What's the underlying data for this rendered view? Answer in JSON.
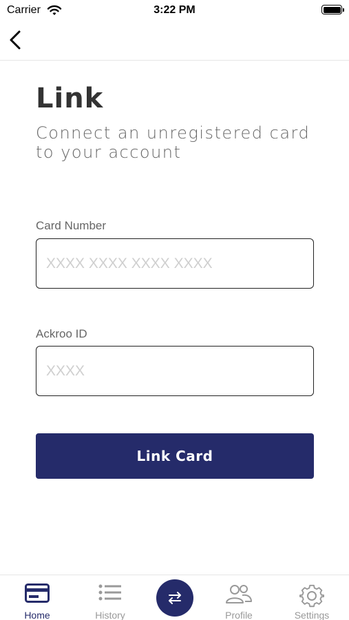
{
  "status_bar": {
    "carrier": "Carrier",
    "time": "3:22 PM"
  },
  "page": {
    "title": "Link",
    "subtitle": "Connect an unregistered card to your account"
  },
  "form": {
    "card_number": {
      "label": "Card Number",
      "placeholder": "XXXX XXXX XXXX XXXX",
      "value": ""
    },
    "ackroo_id": {
      "label": "Ackroo ID",
      "placeholder": "XXXX",
      "value": ""
    },
    "submit_label": "Link Card"
  },
  "tab_bar": {
    "tabs": [
      {
        "label": "Home",
        "icon": "card-icon",
        "active": true
      },
      {
        "label": "History",
        "icon": "list-icon",
        "active": false
      },
      {
        "label": "",
        "icon": "swap-arrows-icon",
        "active": false
      },
      {
        "label": "Profile",
        "icon": "people-icon",
        "active": false
      },
      {
        "label": "Settings",
        "icon": "gear-icon",
        "active": false
      }
    ]
  },
  "colors": {
    "accent": "#252b6a",
    "inactive": "#999999",
    "text": "#333333",
    "subtext": "#666666"
  }
}
